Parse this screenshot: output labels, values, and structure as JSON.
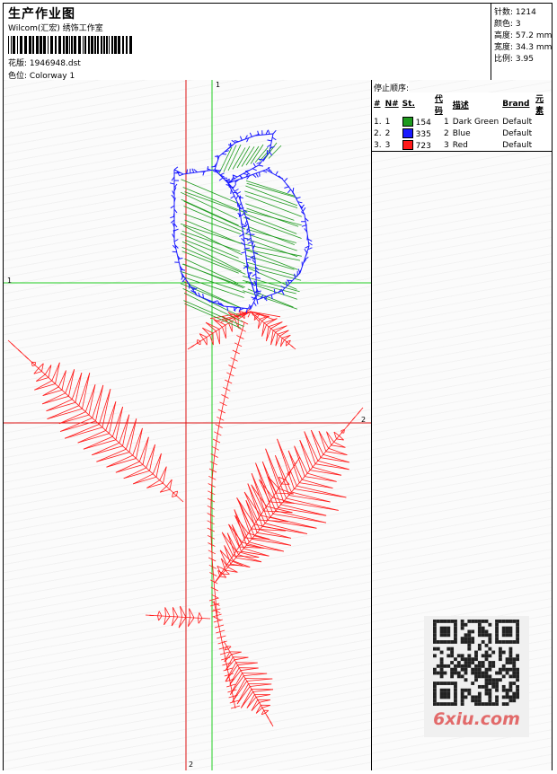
{
  "header": {
    "title": "生产作业图",
    "company": "Wilcom(汇宏) 绣饰工作室",
    "design_label": "花版:",
    "design_value": "1946948.dst",
    "colorway_label": "色位:",
    "colorway_value": "Colorway 1"
  },
  "stats": [
    {
      "label": "针数:",
      "value": "1214"
    },
    {
      "label": "颜色:",
      "value": "3"
    },
    {
      "label": "高度:",
      "value": "57.2 mm"
    },
    {
      "label": "宽度:",
      "value": "34.3 mm"
    },
    {
      "label": "比例:",
      "value": "3.95"
    }
  ],
  "stop_sequence": {
    "title": "停止顺序:",
    "headers": [
      "#",
      "N#",
      "St.",
      "代码",
      "描述",
      "Brand",
      "元素"
    ],
    "rows": [
      {
        "num": "1.",
        "n": "1",
        "color": "#1e9a1e",
        "stitches": "154",
        "code": "1",
        "desc": "Dark Green",
        "brand": "Default"
      },
      {
        "num": "2.",
        "n": "2",
        "color": "#1a1aff",
        "stitches": "335",
        "code": "2",
        "desc": "Blue",
        "brand": "Default"
      },
      {
        "num": "3.",
        "n": "3",
        "color": "#ff1a1a",
        "stitches": "723",
        "code": "3",
        "desc": "Red",
        "brand": "Default"
      }
    ]
  },
  "guides": {
    "green_label": "1",
    "red_label": "2"
  },
  "colors": {
    "green": "#1e9a1e",
    "blue": "#1a1aff",
    "red": "#ff1a1a",
    "guide_green": "#22cc22",
    "guide_red": "#dd1111"
  },
  "watermark": {
    "text": "6xiu.com"
  }
}
